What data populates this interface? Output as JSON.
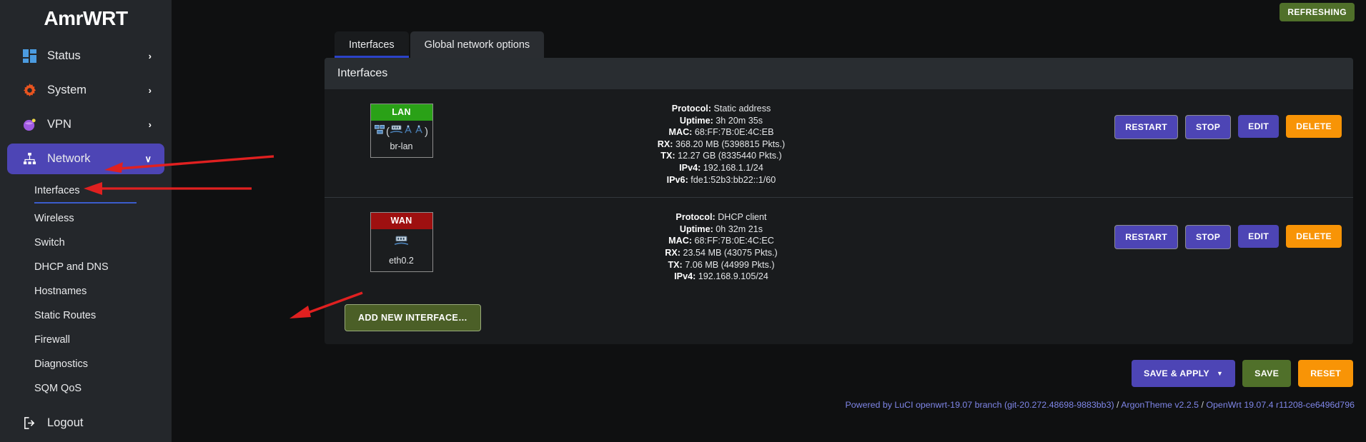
{
  "brand": {
    "name": "AmrWRT"
  },
  "topbar": {
    "refreshing_label": "REFRESHING"
  },
  "sidebar": {
    "items": [
      {
        "label": "Status",
        "icon": "grid-icon",
        "chevron": "›"
      },
      {
        "label": "System",
        "icon": "gear-icon",
        "chevron": "›"
      },
      {
        "label": "VPN",
        "icon": "globe-icon",
        "chevron": "›"
      },
      {
        "label": "Network",
        "icon": "network-icon",
        "chevron": "∨"
      }
    ],
    "network_sub": [
      "Interfaces",
      "Wireless",
      "Switch",
      "DHCP and DNS",
      "Hostnames",
      "Static Routes",
      "Firewall",
      "Diagnostics",
      "SQM QoS"
    ],
    "logout": {
      "label": "Logout",
      "icon": "logout-icon"
    }
  },
  "tabs": [
    {
      "label": "Interfaces",
      "active": true
    },
    {
      "label": "Global network options",
      "active": false
    }
  ],
  "panel": {
    "title": "Interfaces"
  },
  "interfaces": [
    {
      "name": "LAN",
      "badge_color": "#2aa117",
      "device": "br-lan",
      "icons": [
        "bridge-icon",
        "switch-icon",
        "wifi-icon",
        "wifi-icon"
      ],
      "details": [
        {
          "key": "Protocol:",
          "value": "Static address"
        },
        {
          "key": "Uptime:",
          "value": "3h 20m 35s"
        },
        {
          "key": "MAC:",
          "value": "68:FF:7B:0E:4C:EB"
        },
        {
          "key": "RX:",
          "value": "368.20 MB (5398815 Pkts.)"
        },
        {
          "key": "TX:",
          "value": "12.27 GB (8335440 Pkts.)"
        },
        {
          "key": "IPv4:",
          "value": "192.168.1.1/24"
        },
        {
          "key": "IPv6:",
          "value": "fde1:52b3:bb22::1/60"
        }
      ],
      "actions": [
        "RESTART",
        "STOP",
        "EDIT",
        "DELETE"
      ]
    },
    {
      "name": "WAN",
      "badge_color": "#9e1010",
      "device": "eth0.2",
      "icons": [
        "switch-icon"
      ],
      "details": [
        {
          "key": "Protocol:",
          "value": "DHCP client"
        },
        {
          "key": "Uptime:",
          "value": "0h 32m 21s"
        },
        {
          "key": "MAC:",
          "value": "68:FF:7B:0E:4C:EC"
        },
        {
          "key": "RX:",
          "value": "23.54 MB (43075 Pkts.)"
        },
        {
          "key": "TX:",
          "value": "7.06 MB (44999 Pkts.)"
        },
        {
          "key": "IPv4:",
          "value": "192.168.9.105/24"
        }
      ],
      "actions": [
        "RESTART",
        "STOP",
        "EDIT",
        "DELETE"
      ]
    }
  ],
  "add_interface": {
    "label": "ADD NEW INTERFACE…"
  },
  "footer_actions": [
    {
      "label": "SAVE & APPLY",
      "style": "purple",
      "caret": "▼"
    },
    {
      "label": "SAVE",
      "style": "green",
      "caret": ""
    },
    {
      "label": "RESET",
      "style": "orange",
      "caret": ""
    }
  ],
  "footer_credit": {
    "part1": "Powered by LuCI openwrt-19.07 branch (git-20.272.48698-9883bb3)",
    "sep1": " / ",
    "part2": "ArgonTheme v2.2.5",
    "sep2": " / ",
    "part3": "OpenWrt 19.07.4 r11208-ce6496d796"
  },
  "colors": {
    "accent_purple": "#4d45b5",
    "accent_orange": "#f89406",
    "accent_green": "#50702a",
    "lan_green": "#2aa117",
    "wan_red": "#9e1010",
    "tab_underline": "#2b43c9",
    "annotation_red": "#e02020"
  }
}
